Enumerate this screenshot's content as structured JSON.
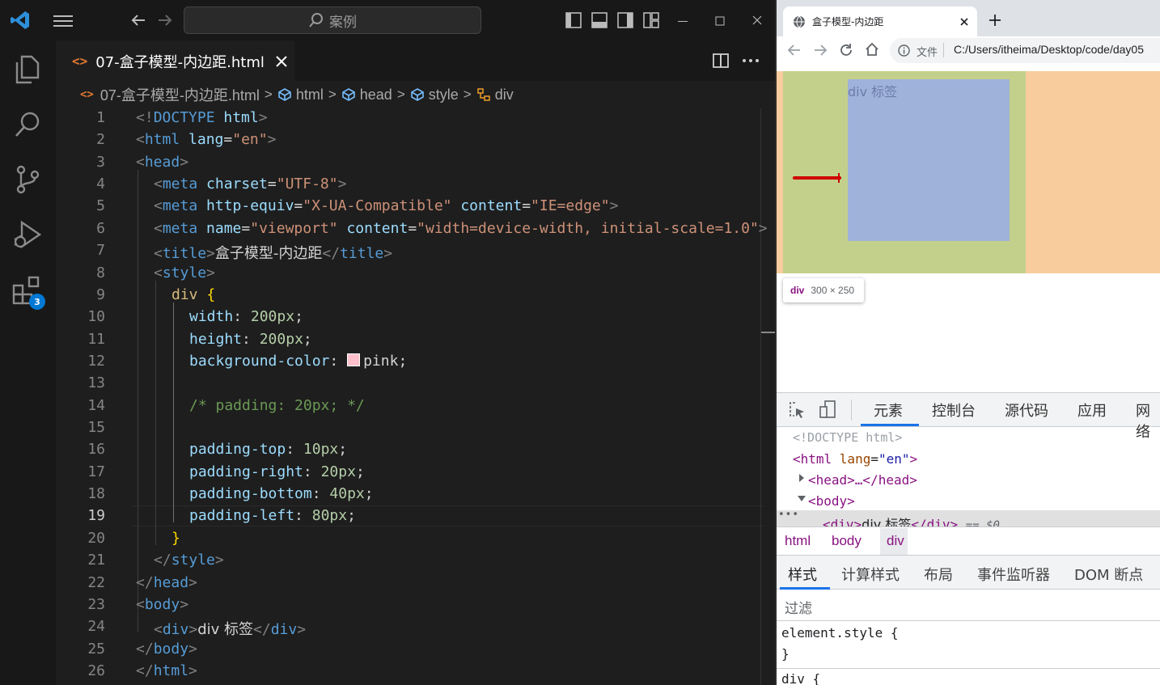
{
  "vscode": {
    "search_placeholder": "案例",
    "tab_title": "07-盒子模型-内边距.html",
    "extensions_badge": "3",
    "breadcrumb": [
      "07-盒子模型-内边距.html",
      "html",
      "head",
      "style",
      "div"
    ],
    "line_numbers": [
      "1",
      "2",
      "3",
      "4",
      "5",
      "6",
      "7",
      "8",
      "9",
      "10",
      "11",
      "12",
      "13",
      "14",
      "15",
      "16",
      "17",
      "18",
      "19",
      "20",
      "21",
      "22",
      "23",
      "24",
      "25",
      "26"
    ],
    "active_line": "19",
    "code": {
      "l1": {
        "a": "<!",
        "b": "DOCTYPE",
        "c": " html",
        "d": ">"
      },
      "l2": {
        "a": "<",
        "b": "html",
        "c": " lang",
        "d": "=",
        "e": "\"en\"",
        "f": ">"
      },
      "l3": {
        "a": "<",
        "b": "head",
        "c": ">"
      },
      "l4": {
        "a": "<",
        "b": "meta",
        "c": " charset",
        "d": "=",
        "e": "\"UTF-8\"",
        "f": ">"
      },
      "l5": {
        "a": "<",
        "b": "meta",
        "c": " http-equiv",
        "d": "=",
        "e": "\"X-UA-Compatible\"",
        "f": " content",
        "g": "=",
        "h": "\"IE=edge\"",
        "i": ">"
      },
      "l6": {
        "a": "<",
        "b": "meta",
        "c": " name",
        "d": "=",
        "e": "\"viewport\"",
        "f": " content",
        "g": "=",
        "h": "\"width=device-width, initial-scale=1.0\"",
        "i": ">"
      },
      "l7": {
        "a": "<",
        "b": "title",
        "c": ">",
        "d": "盒子模型-内边距",
        "e": "</",
        "f": "title",
        "g": ">"
      },
      "l8": {
        "a": "<",
        "b": "style",
        "c": ">"
      },
      "l9": {
        "a": "div",
        "b": " {"
      },
      "l10": {
        "a": "width",
        "b": ": ",
        "c": "200px",
        "d": ";"
      },
      "l11": {
        "a": "height",
        "b": ": ",
        "c": "200px",
        "d": ";"
      },
      "l12": {
        "a": "background-color",
        "b": ": ",
        "c": "pink",
        "d": ";"
      },
      "l14": {
        "a": "/* padding: 20px; */"
      },
      "l16": {
        "a": "padding-top",
        "b": ": ",
        "c": "10px",
        "d": ";"
      },
      "l17": {
        "a": "padding-right",
        "b": ": ",
        "c": "20px",
        "d": ";"
      },
      "l18": {
        "a": "padding-bottom",
        "b": ": ",
        "c": "40px",
        "d": ";"
      },
      "l19": {
        "a": "padding-left",
        "b": ": ",
        "c": "80px",
        "d": ";"
      },
      "l20": {
        "a": "}"
      },
      "l21": {
        "a": "</",
        "b": "style",
        "c": ">"
      },
      "l22": {
        "a": "</",
        "b": "head",
        "c": ">"
      },
      "l23": {
        "a": "<",
        "b": "body",
        "c": ">"
      },
      "l24": {
        "a": "<",
        "b": "div",
        "c": ">",
        "d": "div 标签",
        "e": "</",
        "f": "div",
        "g": ">"
      },
      "l25": {
        "a": "</",
        "b": "body",
        "c": ">"
      },
      "l26": {
        "a": "</",
        "b": "html",
        "c": ">"
      }
    }
  },
  "browser": {
    "tab_title": "盒子模型-内边距",
    "file_label": "文件",
    "url": "C:/Users/itheima/Desktop/code/day05",
    "div_text": "div 标签",
    "tooltip_tag": "div",
    "tooltip_size": "300 × 250",
    "devtools": {
      "tabs": [
        "元素",
        "控制台",
        "源代码",
        "应用",
        "网络"
      ],
      "dom": {
        "doctype": "<!DOCTYPE html>",
        "html_open_a": "<html ",
        "html_attr": "lang",
        "html_eq": "=",
        "html_val": "\"en\"",
        "html_close": ">",
        "head": "<head>…</head>",
        "body": "<body>",
        "div_open": "<div>",
        "div_text": "div 标签",
        "div_close": "</div>",
        "div_marker": "== $0",
        "ellipsis": "•••"
      },
      "crumbs": [
        "html",
        "body",
        "div"
      ],
      "style_tabs": [
        "样式",
        "计算样式",
        "布局",
        "事件监听器",
        "DOM 断点"
      ],
      "filter_placeholder": "过滤",
      "element_style": "element.style {",
      "element_style_close": "}",
      "div_rule": "div {"
    }
  },
  "colors": {
    "pink": "#ffc0cb",
    "margin": "#f9cc9d",
    "padding": "#c3d08b",
    "content": "#9fb2d9",
    "accent": "#1a73e8"
  }
}
